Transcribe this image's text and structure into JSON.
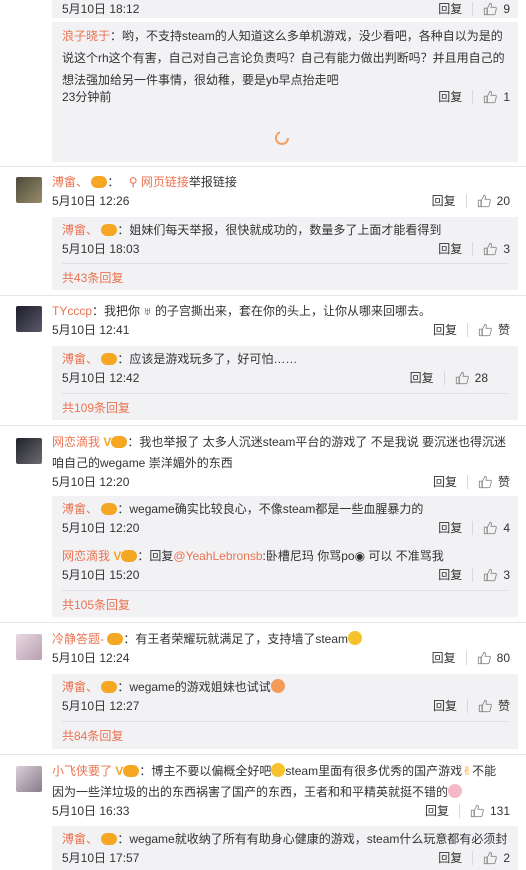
{
  "thumb_color": "#888888",
  "accent": "#eb7350",
  "block0": {
    "time": "5月10日 18:12",
    "reply": "回复",
    "likes": "9"
  },
  "block1": {
    "user": "浪子晓于",
    "text1": "：哟，不支持steam的人知道这么多单机游戏，没少看吧，各种自以为是的",
    "text2": "说这个rh这个有害，自己对自己言论负责吗？自己有能力做出判断吗？并且用自己的",
    "text3": "想法强加给另一件事情，很幼稚，要是yb早点抬走吧",
    "time": "23分钟前",
    "reply": "回复",
    "likes": "1"
  },
  "c1": {
    "user": "溥畲、",
    "link_text": "网页链接",
    "text": "举报链接",
    "time": "5月10日 12:26",
    "reply": "回复",
    "likes": "20",
    "r1_user": "溥畲、",
    "r1_text": "：姐妹们每天举报，很快就成功的，数量多了上面才能看得到",
    "r1_time": "5月10日 18:03",
    "r1_reply": "回复",
    "r1_likes": "3",
    "more": "共43条回复"
  },
  "c2": {
    "user": "TYcccp",
    "text": "：我把你",
    "text_b": "的子宫撕出来，套在你的头上，让你从哪来回哪去。",
    "time": "5月10日 12:41",
    "reply": "回复",
    "likes": "赞",
    "r1_user": "溥畲、",
    "r1_text": "：应该是游戏玩多了，好可怕……",
    "r1_time": "5月10日 12:42",
    "r1_reply": "回复",
    "r1_likes": "28",
    "more": "共109条回复"
  },
  "c3": {
    "user": "网恋滴我",
    "text1": "：我也举报了 太多人沉迷steam平台的游戏了 不是我说 要沉迷也得沉迷",
    "text2": "咱自己的wegame 崇洋媚外的东西",
    "time": "5月10日 12:20",
    "reply": "回复",
    "likes": "赞",
    "r1_user": "溥畲、",
    "r1_text": "：wegame确实比较良心，不像steam都是一些血腥暴力的",
    "r1_time": "5月10日 12:20",
    "r1_reply": "回复",
    "r1_likes": "4",
    "r2_user": "网恋滴我",
    "r2_text_pre": "：回复",
    "r2_mention": "@YeahLebronsb",
    "r2_text": ":卧槽尼玛  你骂po",
    "r2_text2": " 可以  不准骂我",
    "r2_time": "5月10日 15:20",
    "r2_reply": "回复",
    "r2_likes": "3",
    "more": "共105条回复"
  },
  "c4": {
    "user": "冷静答题-",
    "text": "：有王者荣耀玩就满足了，支持墙了steam",
    "time": "5月10日 12:24",
    "reply": "回复",
    "likes": "80",
    "r1_user": "溥畲、",
    "r1_text": "：wegame的游戏姐妹也试试",
    "r1_time": "5月10日 12:27",
    "r1_reply": "回复",
    "r1_likes": "赞",
    "more": "共84条回复"
  },
  "c5": {
    "user": "小飞侠要了",
    "text1": "：博主不要以偏概全好吧",
    "text1b": "steam里面有很多优秀的国产游戏",
    "text1c": "不能",
    "text2": "因为一些洋垃圾的出的东西祸害了国产的东西，王者和和平精英就挺不错的",
    "time": "5月10日 16:33",
    "reply": "回复",
    "likes": "131",
    "r1_user": "溥畲、",
    "r1_text": "：wegame就收纳了所有有助身心健康的游戏，steam什么玩意都有必须封",
    "r1_time": "5月10日 17:57",
    "r1_reply": "回复",
    "r1_likes": "2"
  }
}
